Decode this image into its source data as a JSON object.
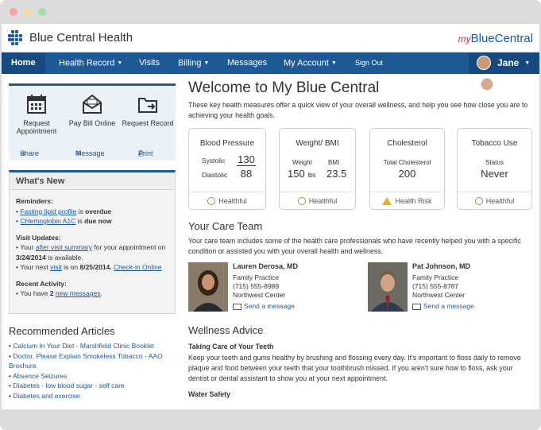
{
  "header": {
    "brand": "Blue Central Health",
    "brand_right_prefix": "my",
    "brand_right": "BlueCentral"
  },
  "nav": {
    "items": [
      {
        "label": "Home"
      },
      {
        "label": "Health Record",
        "caret": "▼"
      },
      {
        "label": "Visits"
      },
      {
        "label": "Billing",
        "caret": "▼"
      },
      {
        "label": "Messages"
      },
      {
        "label": "My Account",
        "caret": "▼"
      },
      {
        "label": "Sign Out"
      }
    ],
    "user_name": "Jane",
    "user_caret": "▼"
  },
  "quick_actions": {
    "items": [
      {
        "label": "Request Appointment",
        "icon": "calendar-icon"
      },
      {
        "label": "Pay Bill Online",
        "icon": "bill-icon"
      },
      {
        "label": "Request Record",
        "icon": "folder-icon"
      }
    ],
    "links": [
      {
        "label": "Share",
        "icon": "share-icon"
      },
      {
        "label": "Message",
        "icon": "message-icon"
      },
      {
        "label": "Print",
        "icon": "print-icon"
      }
    ]
  },
  "whats_new": {
    "title": "What's New",
    "reminders_head": "Reminders:",
    "reminder1_link": "Fasting lipid profile",
    "reminder1_mid": " is ",
    "reminder1_status": "overdue",
    "reminder2_link": "CHemoglobin A1C",
    "reminder2_mid": " is ",
    "reminder2_status": "due now",
    "visit_head": "Visit Updates:",
    "visit1_pre": "Your ",
    "visit1_link": "after visit summary",
    "visit1_post": " for your appointment on ",
    "visit1_date": "3/24/2014",
    "visit1_end": " is available.",
    "visit2_pre": "Your next ",
    "visit2_link": "visit",
    "visit2_mid": " is on ",
    "visit2_date": "8/25/2014.",
    "visit2_link2": "Check-in Online",
    "activity_head": "Recent Activity:",
    "activity_pre": "You have ",
    "activity_count": "2",
    "activity_link": "new messages",
    "activity_end": "."
  },
  "recommended": {
    "title": "Recommended Articles",
    "items": [
      "Calcium In Your Diet - Marshfield Clinic Booklet",
      "Doctor, Please Explain Smokeless Tobacco - AAO Brochure",
      "Absence Seizures",
      "Diabetes - low blood sugar - self care",
      "Diabetes and exercise"
    ]
  },
  "main": {
    "title": "Welcome to My Blue Central",
    "intro": "These key health measures offer a quick view of your overall wellness, and help you see how close you are to achieving your health goals."
  },
  "cards": {
    "bp": {
      "title": "Blood Pressure",
      "label1": "Systolic",
      "value1": "130",
      "label2": "Diastolic",
      "value2": "88",
      "status": "Healthful"
    },
    "weight": {
      "title": "Weight/ BMI",
      "label1": "Weight",
      "label2": "BMI",
      "value1": "150",
      "unit1": "lbs",
      "value2": "23.5",
      "status": "Healthful"
    },
    "chol": {
      "title": "Cholesterol",
      "label": "Total Cholesterol",
      "value": "200",
      "status": "Health Risk"
    },
    "tobacco": {
      "title": "Tobacco Use",
      "label": "Status",
      "value": "Never",
      "status": "Healthful"
    }
  },
  "care_team": {
    "title": "Your Care Team",
    "intro": "Your care team includes some of the health care professionals who have recently helped you with a specific condition or assisted you with your overall health and wellness.",
    "members": [
      {
        "name": "Lauren Derosa, MD",
        "specialty": "Family Practice",
        "phone": "(715) 555-8989",
        "location": "Northwest Center",
        "send": "Send a message"
      },
      {
        "name": "Pat Johnson, MD",
        "specialty": "Family Practice",
        "phone": "(715) 555-8787",
        "location": "Northwest Center",
        "send": "Send a message"
      }
    ]
  },
  "advice": {
    "title": "Wellness Advice",
    "sub1": "Taking Care of Your Teeth",
    "text1": "Keep your teeth and gums healthy by brushing and flossing every day. It's important to floss daily to remove plaque and food between your teeth that your toothbrush missed. If you aren't sure how to floss, ask your dentist or dental assistant to show you at your next appointment.",
    "sub2": "Water Safety"
  },
  "colors": {
    "brand_blue": "#1e5895",
    "nav_blue": "#1e5895",
    "accent_red": "#d9232e",
    "ok_green": "#6ab04c",
    "warn_yellow": "#e8b022"
  }
}
